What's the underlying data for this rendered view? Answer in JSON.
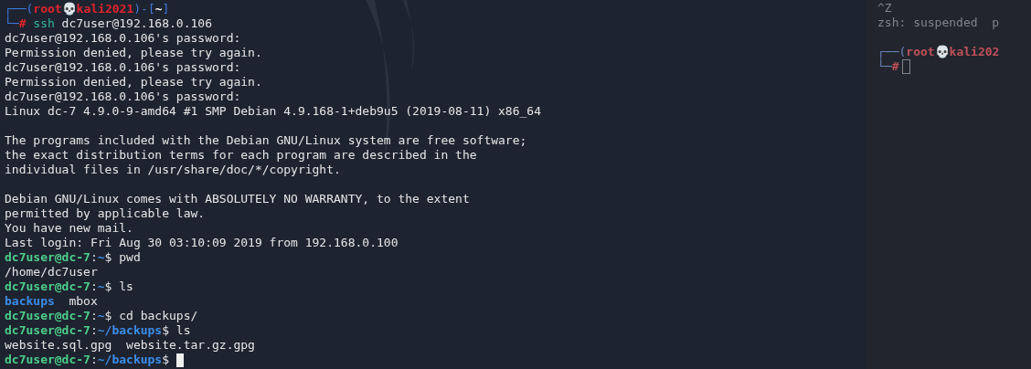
{
  "background_window": {
    "lines": [
      {
        "segments": [
          {
            "kind": "plain",
            "text": "^Z"
          }
        ]
      },
      {
        "segments": [
          {
            "kind": "plain",
            "text": "zsh: suspended  p"
          }
        ]
      },
      {
        "space_before": true,
        "segments": [
          {
            "kind": "frame",
            "text": "┌──("
          },
          {
            "kind": "root",
            "text": "root💀kali202"
          }
        ]
      },
      {
        "cursor": true,
        "segments": [
          {
            "kind": "frame",
            "text": "└─"
          },
          {
            "kind": "root",
            "text": "#"
          }
        ]
      }
    ]
  },
  "terminal": {
    "lines": [
      {
        "segments": [
          {
            "kind": "frame",
            "text": "┌──("
          },
          {
            "kind": "root",
            "text": "root💀kali2021"
          },
          {
            "kind": "frame",
            "text": ")-["
          },
          {
            "kind": "home",
            "text": "~"
          },
          {
            "kind": "frame",
            "text": "]"
          }
        ]
      },
      {
        "segments": [
          {
            "kind": "frame",
            "text": "└─"
          },
          {
            "kind": "root",
            "text": "#"
          },
          {
            "kind": "cmd",
            "text": " ssh"
          },
          {
            "kind": "plain",
            "text": " dc7user@192.168.0.106"
          }
        ]
      },
      {
        "segments": [
          {
            "kind": "plain",
            "text": "dc7user@192.168.0.106's password:"
          }
        ]
      },
      {
        "segments": [
          {
            "kind": "plain",
            "text": "Permission denied, please try again."
          }
        ]
      },
      {
        "segments": [
          {
            "kind": "plain",
            "text": "dc7user@192.168.0.106's password:"
          }
        ]
      },
      {
        "segments": [
          {
            "kind": "plain",
            "text": "Permission denied, please try again."
          }
        ]
      },
      {
        "segments": [
          {
            "kind": "plain",
            "text": "dc7user@192.168.0.106's password:"
          }
        ]
      },
      {
        "segments": [
          {
            "kind": "plain",
            "text": "Linux dc-7 4.9.0-9-amd64 #1 SMP Debian 4.9.168-1+deb9u5 (2019-08-11) x86_64"
          }
        ]
      },
      {
        "space_before": true,
        "segments": [
          {
            "kind": "plain",
            "text": "The programs included with the Debian GNU/Linux system are free software;"
          }
        ]
      },
      {
        "segments": [
          {
            "kind": "plain",
            "text": "the exact distribution terms for each program are described in the"
          }
        ]
      },
      {
        "segments": [
          {
            "kind": "plain",
            "text": "individual files in /usr/share/doc/*/copyright."
          }
        ]
      },
      {
        "space_before": true,
        "segments": [
          {
            "kind": "plain",
            "text": "Debian GNU/Linux comes with ABSOLUTELY NO WARRANTY, to the extent"
          }
        ]
      },
      {
        "segments": [
          {
            "kind": "plain",
            "text": "permitted by applicable law."
          }
        ]
      },
      {
        "segments": [
          {
            "kind": "plain",
            "text": "You have new mail."
          }
        ]
      },
      {
        "segments": [
          {
            "kind": "plain",
            "text": "Last login: Fri Aug 30 03:10:09 2019 from 192.168.0.100"
          }
        ]
      },
      {
        "segments": [
          {
            "kind": "user",
            "text": "dc7user@dc-7"
          },
          {
            "kind": "plain",
            "text": ":"
          },
          {
            "kind": "path",
            "text": "~"
          },
          {
            "kind": "plain",
            "text": "$ pwd"
          }
        ]
      },
      {
        "segments": [
          {
            "kind": "plain",
            "text": "/home/dc7user"
          }
        ]
      },
      {
        "segments": [
          {
            "kind": "user",
            "text": "dc7user@dc-7"
          },
          {
            "kind": "plain",
            "text": ":"
          },
          {
            "kind": "path",
            "text": "~"
          },
          {
            "kind": "plain",
            "text": "$ ls"
          }
        ]
      },
      {
        "segments": [
          {
            "kind": "dir",
            "text": "backups"
          },
          {
            "kind": "plain",
            "text": "  mbox"
          }
        ]
      },
      {
        "segments": [
          {
            "kind": "user",
            "text": "dc7user@dc-7"
          },
          {
            "kind": "plain",
            "text": ":"
          },
          {
            "kind": "path",
            "text": "~"
          },
          {
            "kind": "plain",
            "text": "$ cd backups/"
          }
        ]
      },
      {
        "segments": [
          {
            "kind": "user",
            "text": "dc7user@dc-7"
          },
          {
            "kind": "plain",
            "text": ":"
          },
          {
            "kind": "path",
            "text": "~/backups"
          },
          {
            "kind": "plain",
            "text": "$ ls"
          }
        ]
      },
      {
        "segments": [
          {
            "kind": "plain",
            "text": "website.sql.gpg  website.tar.gz.gpg"
          }
        ]
      },
      {
        "cursor": true,
        "segments": [
          {
            "kind": "user",
            "text": "dc7user@dc-7"
          },
          {
            "kind": "plain",
            "text": ":"
          },
          {
            "kind": "path",
            "text": "~/backups"
          },
          {
            "kind": "plain",
            "text": "$"
          }
        ]
      }
    ]
  }
}
